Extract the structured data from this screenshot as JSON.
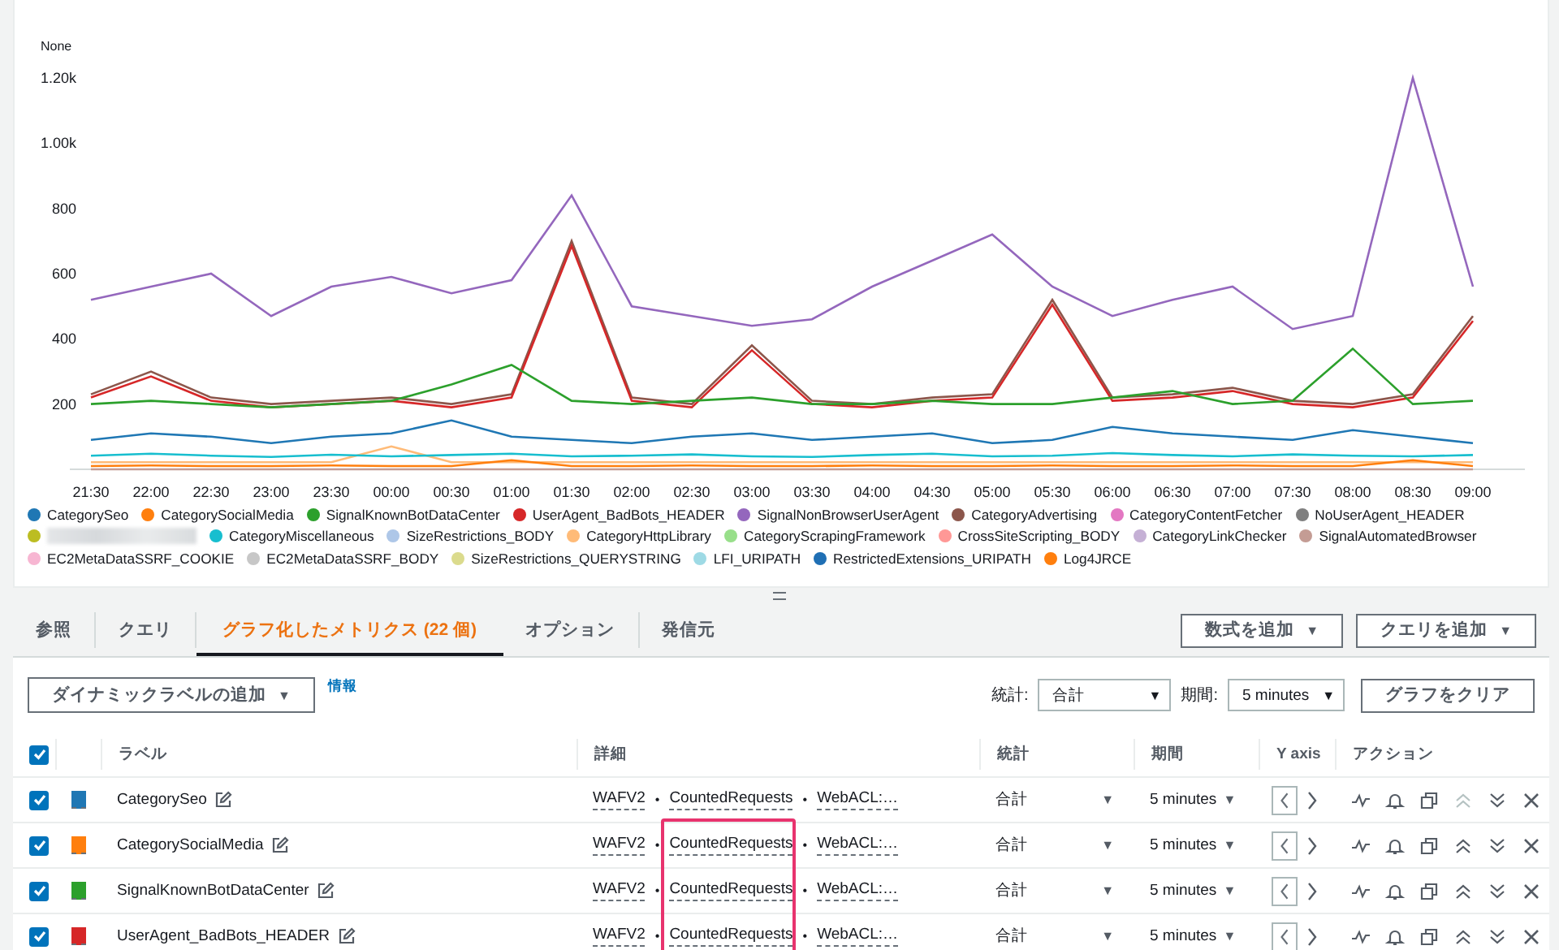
{
  "chart": {
    "unit_label": "None",
    "chart_data": {
      "type": "line",
      "x": [
        "21:30",
        "22:00",
        "22:30",
        "23:00",
        "23:30",
        "00:00",
        "00:30",
        "01:00",
        "01:30",
        "02:00",
        "02:30",
        "03:00",
        "03:30",
        "04:00",
        "04:30",
        "05:00",
        "05:30",
        "06:00",
        "06:30",
        "07:00",
        "07:30",
        "08:00",
        "08:30",
        "09:00"
      ],
      "ylim": [
        0,
        1200
      ],
      "yticks": [
        {
          "value": 200,
          "label": "200"
        },
        {
          "value": 400,
          "label": "400"
        },
        {
          "value": 600,
          "label": "600"
        },
        {
          "value": 800,
          "label": "800"
        },
        {
          "value": 1000,
          "label": "1.00k"
        },
        {
          "value": 1200,
          "label": "1.20k"
        }
      ],
      "series": [
        {
          "name": "CategorySeo",
          "color": "#1f77b4",
          "values": [
            90,
            110,
            100,
            80,
            100,
            110,
            150,
            100,
            90,
            80,
            100,
            110,
            90,
            100,
            110,
            80,
            90,
            130,
            110,
            100,
            90,
            120,
            100,
            80
          ]
        },
        {
          "name": "CategorySocialMedia",
          "color": "#ff7f0e",
          "values": [
            10,
            12,
            10,
            10,
            12,
            10,
            10,
            28,
            10,
            10,
            12,
            10,
            10,
            12,
            10,
            10,
            12,
            10,
            10,
            12,
            10,
            10,
            28,
            10
          ]
        },
        {
          "name": "SignalKnownBotDataCenter",
          "color": "#2ca02c",
          "values": [
            200,
            210,
            200,
            190,
            200,
            210,
            260,
            320,
            210,
            200,
            210,
            220,
            200,
            200,
            210,
            200,
            200,
            220,
            240,
            200,
            210,
            370,
            200,
            210
          ]
        },
        {
          "name": "UserAgent_BadBots_HEADER",
          "color": "#d62728",
          "values": [
            220,
            285,
            210,
            190,
            200,
            210,
            190,
            220,
            685,
            210,
            190,
            365,
            200,
            190,
            210,
            220,
            505,
            210,
            220,
            240,
            200,
            190,
            220,
            455
          ]
        },
        {
          "name": "SignalNonBrowserUserAgent",
          "color": "#9467bd",
          "values": [
            520,
            560,
            600,
            470,
            560,
            590,
            540,
            580,
            840,
            500,
            470,
            440,
            460,
            560,
            640,
            720,
            560,
            470,
            520,
            560,
            430,
            470,
            1200,
            560
          ]
        },
        {
          "name": "CategoryAdvertising",
          "color": "#8c564b",
          "values": [
            230,
            300,
            220,
            200,
            210,
            220,
            200,
            230,
            700,
            220,
            200,
            380,
            210,
            200,
            220,
            230,
            520,
            220,
            230,
            250,
            210,
            200,
            230,
            470
          ]
        },
        {
          "name": "CategoryContentFetcher",
          "color": "#e377c2",
          "values": [
            null,
            null,
            null,
            null,
            null,
            null,
            null,
            null,
            null,
            null,
            null,
            null,
            null,
            null,
            null,
            null,
            null,
            null,
            null,
            null,
            null,
            null,
            null,
            null
          ]
        },
        {
          "name": "NoUserAgent_HEADER",
          "color": "#7f7f7f",
          "values": [
            null,
            null,
            null,
            null,
            null,
            null,
            null,
            null,
            null,
            null,
            null,
            null,
            null,
            null,
            null,
            null,
            null,
            null,
            null,
            null,
            null,
            null,
            null,
            null
          ]
        },
        {
          "color": "#bcbd22",
          "values": [
            null,
            null,
            null,
            null,
            null,
            null,
            null,
            null,
            null,
            null,
            null,
            null,
            null,
            null,
            null,
            null,
            null,
            null,
            null,
            null,
            null,
            null,
            null,
            null
          ]
        },
        {
          "name": "CategoryMiscellaneous",
          "color": "#17becf",
          "values": [
            42,
            48,
            42,
            38,
            45,
            40,
            44,
            48,
            40,
            42,
            46,
            40,
            38,
            44,
            48,
            40,
            42,
            50,
            44,
            40,
            46,
            42,
            40,
            44
          ]
        },
        {
          "name": "SizeRestrictions_BODY",
          "color": "#aec7e8",
          "values": [
            null,
            null,
            null,
            null,
            null,
            null,
            null,
            null,
            null,
            null,
            null,
            null,
            null,
            null,
            null,
            null,
            null,
            null,
            null,
            null,
            null,
            null,
            null,
            null
          ]
        },
        {
          "name": "CategoryHttpLibrary",
          "color": "#ffbb78",
          "values": [
            22,
            22,
            22,
            22,
            22,
            70,
            22,
            22,
            22,
            22,
            22,
            22,
            22,
            22,
            22,
            22,
            22,
            22,
            22,
            22,
            22,
            22,
            22,
            22
          ]
        },
        {
          "name": "CategoryScrapingFramework",
          "color": "#98df8a",
          "values": [
            null,
            null,
            null,
            null,
            null,
            null,
            null,
            null,
            null,
            null,
            null,
            null,
            null,
            null,
            null,
            null,
            null,
            null,
            null,
            null,
            null,
            null,
            null,
            null
          ]
        },
        {
          "name": "CrossSiteScripting_BODY",
          "color": "#ff9896",
          "values": [
            null,
            null,
            null,
            null,
            null,
            null,
            null,
            null,
            null,
            null,
            null,
            null,
            null,
            null,
            null,
            null,
            null,
            null,
            null,
            null,
            null,
            null,
            null,
            null
          ]
        },
        {
          "name": "CategoryLinkChecker",
          "color": "#c5b0d5",
          "values": [
            null,
            null,
            null,
            null,
            null,
            null,
            null,
            null,
            null,
            null,
            null,
            null,
            null,
            null,
            null,
            null,
            null,
            null,
            null,
            null,
            null,
            null,
            null,
            null
          ]
        },
        {
          "name": "SignalAutomatedBrowser",
          "color": "#c49c94",
          "values": [
            0,
            0,
            0,
            0,
            0,
            0,
            0,
            0,
            0,
            0,
            0,
            0,
            0,
            0,
            0,
            0,
            0,
            0,
            0,
            0,
            0,
            0,
            0,
            0
          ]
        },
        {
          "name": "EC2MetaDataSSRF_COOKIE",
          "color": "#f7b6d2",
          "values": [
            null,
            null,
            null,
            null,
            null,
            null,
            null,
            null,
            null,
            null,
            null,
            null,
            null,
            null,
            null,
            null,
            null,
            null,
            null,
            null,
            null,
            null,
            null,
            null
          ]
        },
        {
          "name": "EC2MetaDataSSRF_BODY",
          "color": "#c7c7c7",
          "values": [
            null,
            null,
            null,
            null,
            null,
            null,
            null,
            null,
            null,
            null,
            null,
            null,
            null,
            null,
            null,
            null,
            null,
            null,
            null,
            null,
            null,
            null,
            null,
            null
          ]
        },
        {
          "name": "SizeRestrictions_QUERYSTRING",
          "color": "#dbdb8d",
          "values": [
            null,
            null,
            null,
            null,
            null,
            null,
            null,
            null,
            null,
            null,
            null,
            null,
            null,
            null,
            null,
            null,
            null,
            null,
            null,
            null,
            null,
            null,
            null,
            null
          ]
        },
        {
          "name": "LFI_URIPATH",
          "color": "#9edae5",
          "values": [
            null,
            null,
            null,
            null,
            null,
            null,
            null,
            null,
            null,
            null,
            null,
            null,
            null,
            null,
            null,
            null,
            null,
            null,
            null,
            null,
            null,
            null,
            null,
            null
          ]
        },
        {
          "name": "RestrictedExtensions_URIPATH",
          "color": "#1f6fb4",
          "values": [
            null,
            null,
            null,
            null,
            null,
            null,
            null,
            null,
            null,
            null,
            null,
            null,
            null,
            null,
            null,
            null,
            null,
            null,
            null,
            null,
            null,
            null,
            null,
            null
          ]
        },
        {
          "name": "Log4JRCE",
          "color": "#ff7f0e",
          "values": [
            null,
            null,
            null,
            null,
            null,
            null,
            null,
            null,
            null,
            null,
            null,
            null,
            null,
            null,
            null,
            null,
            null,
            null,
            null,
            null,
            null,
            null,
            null,
            null
          ]
        }
      ]
    }
  },
  "tabs": [
    {
      "label": "参照",
      "selected": false
    },
    {
      "label": "クエリ",
      "selected": false
    },
    {
      "label": "グラフ化したメトリクス (22 個)",
      "selected": true
    },
    {
      "label": "オプション",
      "selected": false
    },
    {
      "label": "発信元",
      "selected": false
    }
  ],
  "tab_buttons": [
    {
      "label": "数式を追加",
      "caret": "▼"
    },
    {
      "label": "クエリを追加",
      "caret": "▼"
    }
  ],
  "toolbar": {
    "dynamic_label_button": {
      "label": "ダイナミックラベルの追加",
      "caret": "▼"
    },
    "info_link": "情報",
    "stat_label": "統計:",
    "stat_select": {
      "value": "合計",
      "caret": "▼"
    },
    "period_label": "期間:",
    "period_select": {
      "value": "5 minutes",
      "caret": "▼"
    },
    "clear_button": "グラフをクリア"
  },
  "table": {
    "select_all_checked": true,
    "columns": [
      "ラベル",
      "詳細",
      "統計",
      "期間",
      "Y axis",
      "アクション"
    ],
    "rows": [
      {
        "checked": true,
        "color": "#1f77b4",
        "label": "CategorySeo",
        "detail": [
          "WAFV2",
          "CountedRequests",
          "WebACL:…"
        ],
        "separator": "•",
        "stat": "合計",
        "stat_caret": "▼",
        "period": "5 minutes",
        "period_caret": "▼",
        "y_axis_left": true,
        "move_up_disabled": true
      },
      {
        "checked": true,
        "color": "#ff7f0e",
        "label": "CategorySocialMedia",
        "detail": [
          "WAFV2",
          "CountedRequests",
          "WebACL:…"
        ],
        "separator": "•",
        "stat": "合計",
        "stat_caret": "▼",
        "period": "5 minutes",
        "period_caret": "▼",
        "y_axis_left": true,
        "move_up_disabled": false
      },
      {
        "checked": true,
        "color": "#2ca02c",
        "label": "SignalKnownBotDataCenter",
        "detail": [
          "WAFV2",
          "CountedRequests",
          "WebACL:…"
        ],
        "separator": "•",
        "stat": "合計",
        "stat_caret": "▼",
        "period": "5 minutes",
        "period_caret": "▼",
        "y_axis_left": true,
        "move_up_disabled": false
      },
      {
        "checked": true,
        "color": "#d62728",
        "label": "UserAgent_BadBots_HEADER",
        "detail": [
          "WAFV2",
          "CountedRequests",
          "WebACL:…"
        ],
        "separator": "•",
        "stat": "合計",
        "stat_caret": "▼",
        "period": "5 minutes",
        "period_caret": "▼",
        "y_axis_left": true,
        "move_up_disabled": false
      }
    ]
  }
}
